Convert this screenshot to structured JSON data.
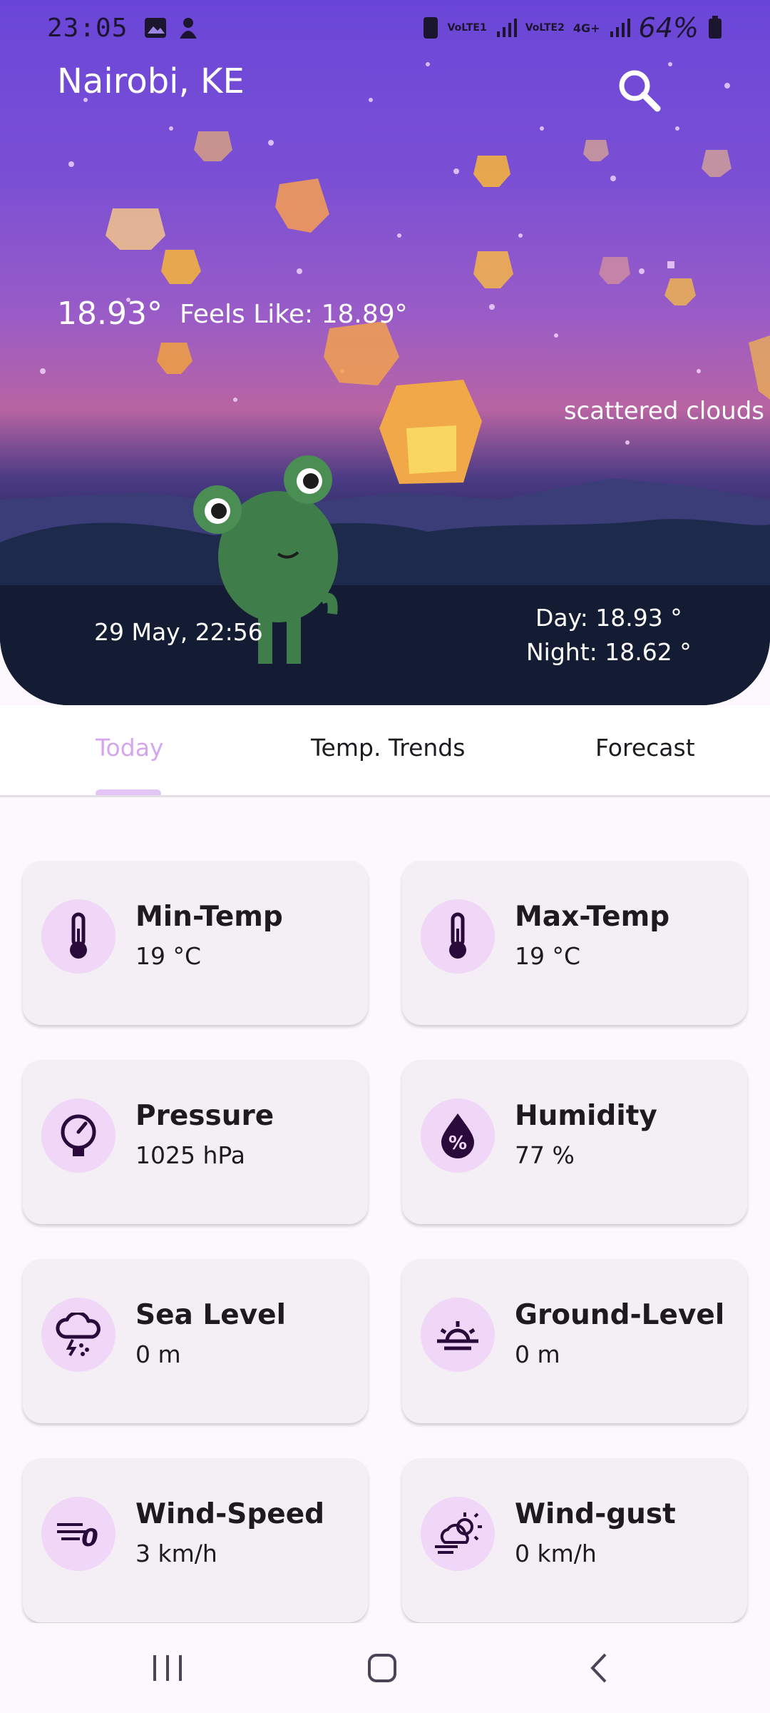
{
  "status_bar": {
    "time": "23:05",
    "battery": "64%",
    "icons": [
      "gallery-icon",
      "notification-icon",
      "alarm-icon",
      "volte1-icon",
      "signal1-icon",
      "volte2-icon",
      "4g-icon",
      "signal2-icon",
      "battery-icon"
    ],
    "volte1": "VoLTE1",
    "volte2": "VoLTE2",
    "net": "4G+"
  },
  "header": {
    "city": "Nairobi, KE",
    "search_icon": "search-icon"
  },
  "current": {
    "temp": "18.93°",
    "feels_like": "Feels Like: 18.89°",
    "description": "scattered clouds",
    "datetime": "29 May, 22:56",
    "day": "Day: 18.93 °",
    "night": "Night: 18.62 °"
  },
  "tabs": [
    {
      "label": "Today",
      "active": true
    },
    {
      "label": "Temp. Trends",
      "active": false
    },
    {
      "label": "Forecast",
      "active": false
    }
  ],
  "cards": [
    {
      "label": "Min-Temp",
      "value": "19 °C",
      "icon": "thermometer-icon"
    },
    {
      "label": "Max-Temp",
      "value": "19 °C",
      "icon": "thermometer-icon"
    },
    {
      "label": "Pressure",
      "value": "1025 hPa",
      "icon": "gauge-icon"
    },
    {
      "label": "Humidity",
      "value": "77 %",
      "icon": "humidity-drop-icon"
    },
    {
      "label": "Sea Level",
      "value": "0 m",
      "icon": "storm-cloud-icon"
    },
    {
      "label": "Ground-Level",
      "value": "0 m",
      "icon": "sunset-icon"
    },
    {
      "label": "Wind-Speed",
      "value": "3 km/h",
      "icon": "wind-icon"
    },
    {
      "label": "Wind-gust",
      "value": "0 km/h",
      "icon": "windy-sun-cloud-icon"
    }
  ],
  "colors": {
    "accent": "#d3a6ee",
    "card_bg": "#f4eff5",
    "icon_circle": "#f0d6f7",
    "icon_fg": "#2a0a3a"
  },
  "nav": [
    "recents-icon",
    "home-icon",
    "back-icon"
  ]
}
